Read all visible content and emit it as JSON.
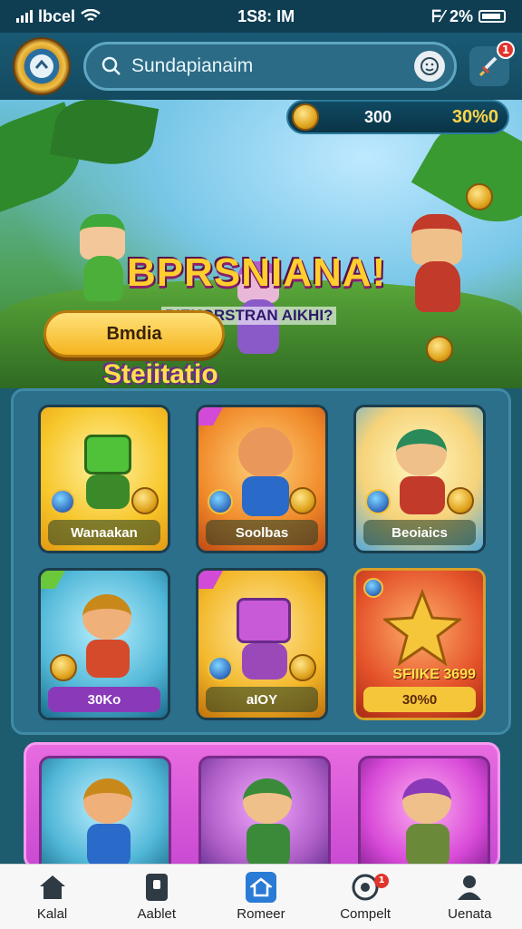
{
  "status_bar": {
    "carrier": "lbcel",
    "time": "1S8: IM",
    "extra": "ᖴ⁄",
    "battery_pct": "2%"
  },
  "header": {
    "search_text": "Sundapianaim",
    "notification_count": "1"
  },
  "currency": {
    "value_1": "300",
    "value_2": "30%0"
  },
  "hero": {
    "title": "BPRSNIANA!",
    "subtitle": "RIEKORSTRAN AIKHI?",
    "tag": "Steiitatio",
    "cta_label": "Bmdia"
  },
  "cards": [
    {
      "label": "Wanaakan",
      "theme": "#f7c62a"
    },
    {
      "label": "Soolbas",
      "theme": "#f08a2a"
    },
    {
      "label": "Beoiaics",
      "theme": "#f6d37a"
    },
    {
      "label": "30Ko",
      "theme": "#52b8d8"
    },
    {
      "label": "aIOY",
      "theme": "#f3b82a"
    },
    {
      "label": "30%0",
      "theme": "#e4522a",
      "title": "SFIIKE 3699"
    }
  ],
  "bottom_nav": [
    {
      "label": "Kalal",
      "icon": "home-icon"
    },
    {
      "label": "Aablet",
      "icon": "tablet-icon"
    },
    {
      "label": "Romeer",
      "icon": "shop-house-icon",
      "active": true
    },
    {
      "label": "Compelt",
      "icon": "compete-icon",
      "badge": "1"
    },
    {
      "label": "Uenata",
      "icon": "user-icon"
    }
  ],
  "colors": {
    "header_bg": "#134a60",
    "gold": "#f5b41e",
    "accent_blue": "#2a7bd6",
    "badge_red": "#e0342c"
  }
}
